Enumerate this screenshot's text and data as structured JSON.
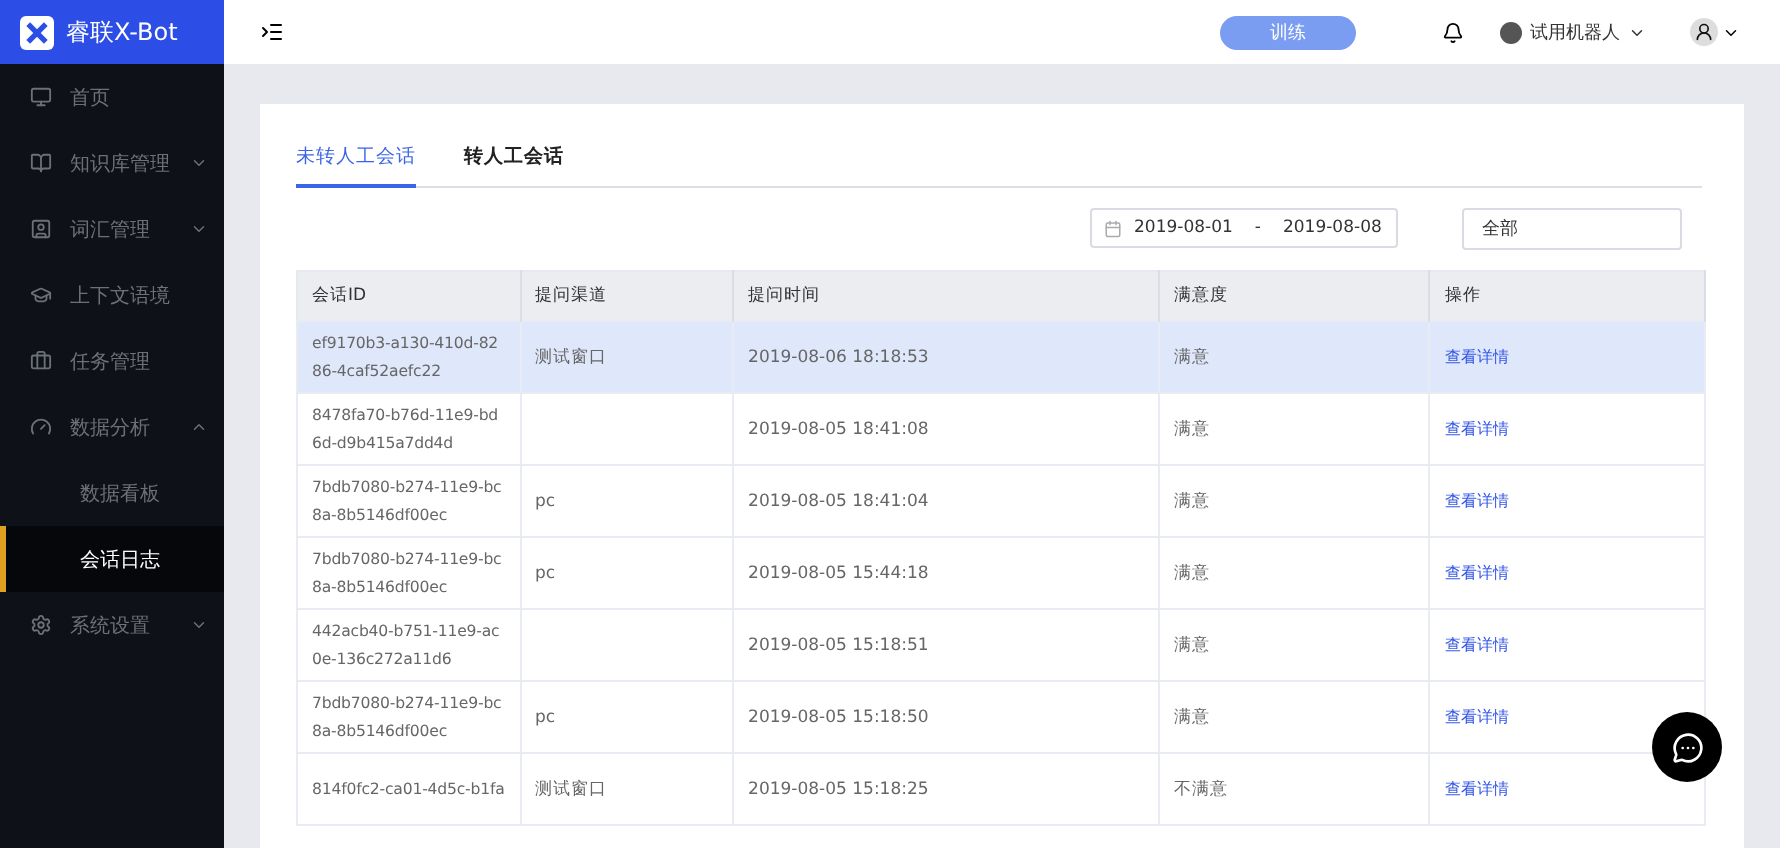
{
  "brand": {
    "name": "睿联X-Bot"
  },
  "sidebar": {
    "items": [
      {
        "label": "首页",
        "selected": false
      },
      {
        "label": "知识库管理",
        "expanded": false,
        "selected": false
      },
      {
        "label": "词汇管理",
        "expanded": false,
        "selected": false
      },
      {
        "label": "上下文语境",
        "selected": false
      },
      {
        "label": "任务管理",
        "selected": false
      },
      {
        "label": "数据分析",
        "expanded": true,
        "selected": false,
        "children": [
          {
            "label": "数据看板",
            "selected": false
          },
          {
            "label": "会话日志",
            "selected": true
          }
        ]
      },
      {
        "label": "系统设置",
        "expanded": false,
        "selected": false
      }
    ]
  },
  "topbar": {
    "train_button": "训练",
    "bot_name": "试用机器人"
  },
  "tabs": [
    {
      "label": "未转人工会话",
      "selected": true
    },
    {
      "label": "转人工会话",
      "selected": false
    }
  ],
  "filters": {
    "date_start": "2019-08-01",
    "date_separator": "-",
    "date_end": "2019-08-08",
    "select_value": "全部"
  },
  "table": {
    "columns": [
      "会话ID",
      "提问渠道",
      "提问时间",
      "满意度",
      "操作"
    ],
    "rows": [
      {
        "id": "ef9170b3-a130-410d-8286-4caf52aefc22",
        "channel": "测试窗口",
        "time": "2019-08-06 18:18:53",
        "satisfaction": "满意",
        "action": "查看详情",
        "selected": true
      },
      {
        "id": "8478fa70-b76d-11e9-bd6d-d9b415a7dd4d",
        "time": "2019-08-05 18:41:08",
        "satisfaction": "满意",
        "action": "查看详情",
        "selected": false
      },
      {
        "id": "7bdb7080-b274-11e9-bc8a-8b5146df00ec",
        "channel": "pc",
        "time": "2019-08-05 18:41:04",
        "satisfaction": "满意",
        "action": "查看详情",
        "selected": false
      },
      {
        "id": "7bdb7080-b274-11e9-bc8a-8b5146df00ec",
        "channel": "pc",
        "time": "2019-08-05 15:44:18",
        "satisfaction": "满意",
        "action": "查看详情",
        "selected": false
      },
      {
        "id": "442acb40-b751-11e9-ac0e-136c272a11d6",
        "time": "2019-08-05 15:18:51",
        "satisfaction": "满意",
        "action": "查看详情",
        "selected": false
      },
      {
        "id": "7bdb7080-b274-11e9-bc8a-8b5146df00ec",
        "channel": "pc",
        "time": "2019-08-05 15:18:50",
        "satisfaction": "满意",
        "action": "查看详情",
        "selected": false
      },
      {
        "id": "814f0fc2-ca01-4d5c-b1fa",
        "channel": "测试窗口",
        "time": "2019-08-05 15:18:25",
        "satisfaction": "不满意",
        "action": "查看详情",
        "selected": false
      }
    ]
  }
}
